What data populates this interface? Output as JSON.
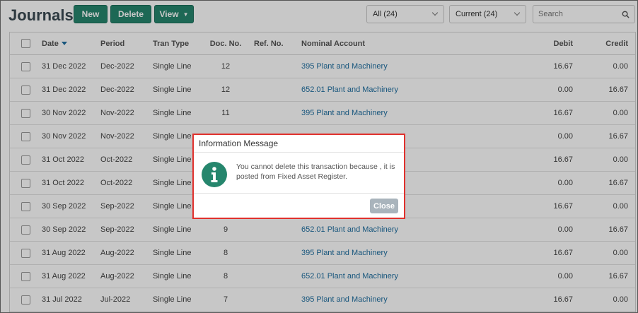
{
  "header": {
    "title": "Journals",
    "buttons": {
      "new": "New",
      "delete": "Delete",
      "view": "View"
    },
    "filters": {
      "all": "All (24)",
      "current": "Current (24)"
    },
    "search_placeholder": "Search"
  },
  "table": {
    "columns": {
      "date": "Date",
      "period": "Period",
      "tran_type": "Tran Type",
      "doc_no": "Doc. No.",
      "ref_no": "Ref. No.",
      "nominal_account": "Nominal Account",
      "debit": "Debit",
      "credit": "Credit"
    },
    "rows": [
      {
        "date": "31 Dec 2022",
        "period": "Dec-2022",
        "type": "Single Line",
        "doc": "12",
        "ref": "",
        "account": "395 Plant and Machinery",
        "debit": "16.67",
        "credit": "0.00"
      },
      {
        "date": "31 Dec 2022",
        "period": "Dec-2022",
        "type": "Single Line",
        "doc": "12",
        "ref": "",
        "account": "652.01 Plant and Machinery",
        "debit": "0.00",
        "credit": "16.67"
      },
      {
        "date": "30 Nov 2022",
        "period": "Nov-2022",
        "type": "Single Line",
        "doc": "11",
        "ref": "",
        "account": "395 Plant and Machinery",
        "debit": "16.67",
        "credit": "0.00"
      },
      {
        "date": "30 Nov 2022",
        "period": "Nov-2022",
        "type": "Single Line",
        "doc": "",
        "ref": "",
        "account": "",
        "debit": "0.00",
        "credit": "16.67"
      },
      {
        "date": "31 Oct 2022",
        "period": "Oct-2022",
        "type": "Single Line",
        "doc": "",
        "ref": "",
        "account": "",
        "debit": "16.67",
        "credit": "0.00"
      },
      {
        "date": "31 Oct 2022",
        "period": "Oct-2022",
        "type": "Single Line",
        "doc": "",
        "ref": "",
        "account": "",
        "debit": "0.00",
        "credit": "16.67"
      },
      {
        "date": "30 Sep 2022",
        "period": "Sep-2022",
        "type": "Single Line",
        "doc": "",
        "ref": "",
        "account": "",
        "debit": "16.67",
        "credit": "0.00"
      },
      {
        "date": "30 Sep 2022",
        "period": "Sep-2022",
        "type": "Single Line",
        "doc": "9",
        "ref": "",
        "account": "652.01 Plant and Machinery",
        "debit": "0.00",
        "credit": "16.67"
      },
      {
        "date": "31 Aug 2022",
        "period": "Aug-2022",
        "type": "Single Line",
        "doc": "8",
        "ref": "",
        "account": "395 Plant and Machinery",
        "debit": "16.67",
        "credit": "0.00"
      },
      {
        "date": "31 Aug 2022",
        "period": "Aug-2022",
        "type": "Single Line",
        "doc": "8",
        "ref": "",
        "account": "652.01 Plant and Machinery",
        "debit": "0.00",
        "credit": "16.67"
      },
      {
        "date": "31 Jul 2022",
        "period": "Jul-2022",
        "type": "Single Line",
        "doc": "7",
        "ref": "",
        "account": "395 Plant and Machinery",
        "debit": "16.67",
        "credit": "0.00"
      }
    ]
  },
  "modal": {
    "title": "Information Message",
    "message": "You cannot delete this transaction because , it is posted from Fixed Asset Register.",
    "close_label": "Close"
  },
  "colors": {
    "primary_button": "#26866d",
    "link": "#1f6fa0",
    "info_icon": "#26866d",
    "modal_border": "#e0312d",
    "close_button": "#a9b4bc"
  }
}
